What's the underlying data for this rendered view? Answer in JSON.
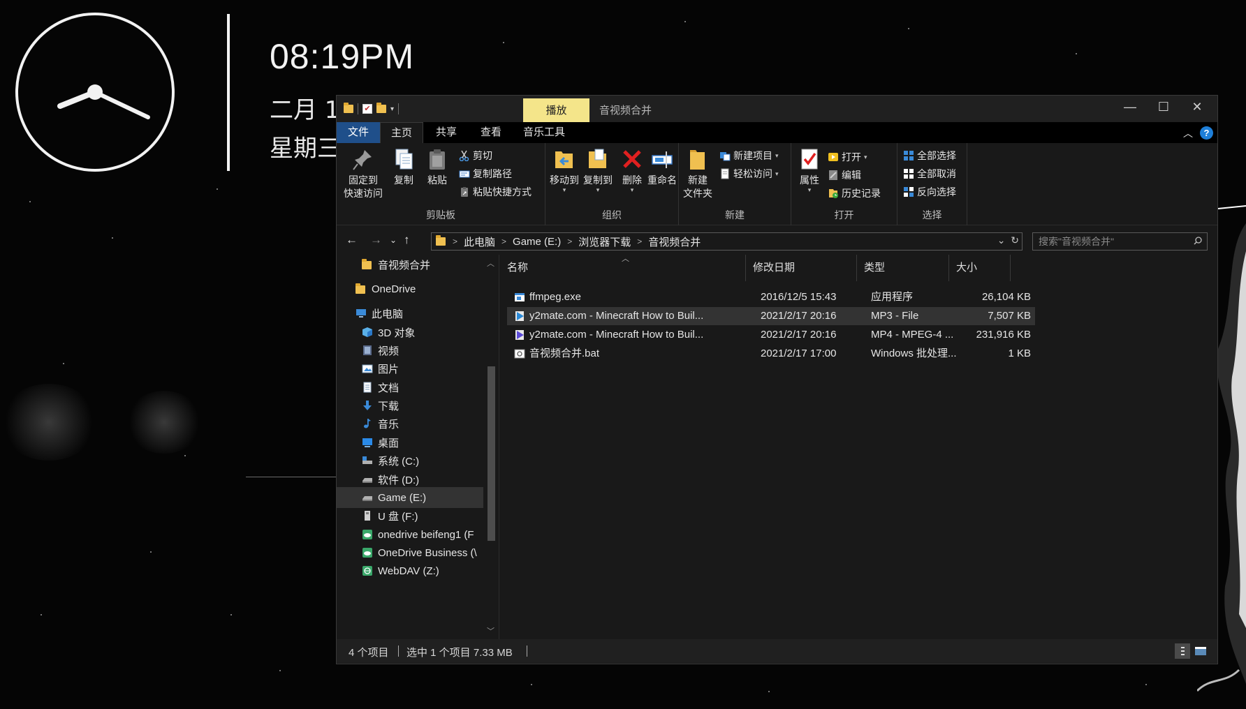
{
  "desktop": {
    "time": "08:19PM",
    "date": "二月 1",
    "weekday": "星期三"
  },
  "window": {
    "title": "音视频合并",
    "context_tab": "播放",
    "controls": {
      "minimize": "—",
      "maximize": "☐",
      "close": "✕"
    }
  },
  "tabs": [
    {
      "label": "文件"
    },
    {
      "label": "主页"
    },
    {
      "label": "共享"
    },
    {
      "label": "查看"
    },
    {
      "label": "音乐工具"
    }
  ],
  "ribbon": {
    "clipboard": {
      "label": "剪贴板",
      "pin_line1": "固定到",
      "pin_line2": "快速访问",
      "copy": "复制",
      "paste": "粘贴",
      "cut": "剪切",
      "copy_path": "复制路径",
      "paste_shortcut": "粘贴快捷方式"
    },
    "organize": {
      "label": "组织",
      "move_to": "移动到",
      "copy_to": "复制到",
      "delete": "删除",
      "rename": "重命名"
    },
    "new": {
      "label": "新建",
      "new_folder_line1": "新建",
      "new_folder_line2": "文件夹",
      "new_item": "新建项目",
      "easy_access": "轻松访问"
    },
    "open": {
      "label": "打开",
      "properties": "属性",
      "open": "打开",
      "edit": "编辑",
      "history": "历史记录"
    },
    "select": {
      "label": "选择",
      "select_all": "全部选择",
      "select_none": "全部取消",
      "invert": "反向选择"
    }
  },
  "address": {
    "crumbs": [
      "此电脑",
      "Game (E:)",
      "浏览器下载",
      "音视频合并"
    ],
    "search_placeholder": "搜索\"音视频合并\""
  },
  "nav": [
    {
      "label": "音视频合并",
      "icon": "folder-icon"
    },
    {
      "label": "OneDrive",
      "icon": "folder-icon"
    },
    {
      "label": "此电脑",
      "icon": "computer-icon"
    },
    {
      "label": "3D 对象",
      "icon": "3d-objects-icon"
    },
    {
      "label": "视频",
      "icon": "video-icon"
    },
    {
      "label": "图片",
      "icon": "pictures-icon"
    },
    {
      "label": "文档",
      "icon": "documents-icon"
    },
    {
      "label": "下载",
      "icon": "download-icon"
    },
    {
      "label": "音乐",
      "icon": "music-icon"
    },
    {
      "label": "桌面",
      "icon": "desktop-icon"
    },
    {
      "label": "系统 (C:)",
      "icon": "drive-icon"
    },
    {
      "label": "软件 (D:)",
      "icon": "drive-icon"
    },
    {
      "label": "Game (E:)",
      "icon": "drive-icon"
    },
    {
      "label": "U 盘 (F:)",
      "icon": "usb-drive-icon"
    },
    {
      "label": "onedrive beifeng1 (F",
      "icon": "network-drive-icon"
    },
    {
      "label": "OneDrive Business (\\",
      "icon": "network-drive-icon"
    },
    {
      "label": "WebDAV (Z:)",
      "icon": "network-drive-icon"
    }
  ],
  "columns": {
    "name": "名称",
    "modified": "修改日期",
    "type": "类型",
    "size": "大小"
  },
  "files": [
    {
      "name": "ffmpeg.exe",
      "modified": "2016/12/5 15:43",
      "type": "应用程序",
      "size": "26,104 KB",
      "icon": "exe-icon"
    },
    {
      "name": "y2mate.com - Minecraft  How to Buil...",
      "modified": "2021/2/17 20:16",
      "type": "MP3 - File",
      "size": "7,507 KB",
      "icon": "mp3-icon"
    },
    {
      "name": "y2mate.com - Minecraft  How to Buil...",
      "modified": "2021/2/17 20:16",
      "type": "MP4 - MPEG-4 ...",
      "size": "231,916 KB",
      "icon": "mp4-icon"
    },
    {
      "name": "音视频合并.bat",
      "modified": "2021/2/17 17:00",
      "type": "Windows 批处理...",
      "size": "1 KB",
      "icon": "bat-icon"
    }
  ],
  "status": {
    "count": "4 个项目",
    "selection": "选中 1 个项目  7.33 MB"
  },
  "colors": {
    "file_tab": "#1f4f8a",
    "context_tab": "#f4e58a",
    "selection": "#333333",
    "background": "#191919"
  }
}
